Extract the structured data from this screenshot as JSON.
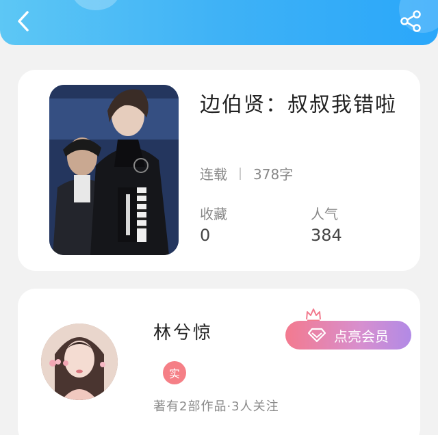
{
  "header": {
    "back_icon": "back-chevron-icon",
    "share_icon": "share-icon",
    "gradient": [
      "#5dc7f5",
      "#2aa7fa"
    ]
  },
  "book": {
    "title": "边伯贤：叔叔我错啦",
    "status": "连载",
    "word_count": "378字",
    "favorites_label": "收藏",
    "favorites_value": "0",
    "popularity_label": "人气",
    "popularity_value": "384"
  },
  "author": {
    "name": "林兮惊",
    "verified_badge": "实",
    "meta": "著有2部作品·3人关注",
    "vip_button_label": "点亮会员",
    "vip_colors": [
      "#f37a8f",
      "#b18ae6"
    ]
  }
}
